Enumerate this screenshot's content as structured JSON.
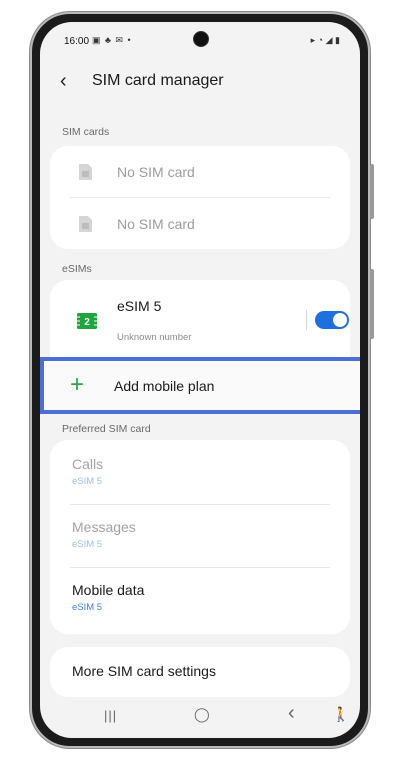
{
  "status_bar": {
    "time": "16:00",
    "left_icons": "▣ ♣ ✉ •",
    "right_icons": "▸ ◔ ◢ ▮"
  },
  "header": {
    "title": "SIM card manager"
  },
  "sim_cards": {
    "section_label": "SIM cards",
    "items": [
      {
        "label": "No SIM card"
      },
      {
        "label": "No SIM card"
      }
    ]
  },
  "esims": {
    "section_label": "eSIMs",
    "item": {
      "name": "eSIM 5",
      "subtitle": "Unknown number",
      "badge": "2",
      "enabled": true
    },
    "add_label": "Add mobile plan"
  },
  "preferred": {
    "section_label": "Preferred SIM card",
    "items": [
      {
        "title": "Calls",
        "value": "eSIM 5"
      },
      {
        "title": "Messages",
        "value": "eSIM 5"
      },
      {
        "title": "Mobile data",
        "value": "eSIM 5"
      }
    ]
  },
  "more_settings_label": "More SIM card settings",
  "navbar": {
    "recents": "|||",
    "home": "◯",
    "back": "‹",
    "accessibility": "🚶"
  },
  "colors": {
    "accent_blue": "#1f6fe0",
    "highlight_border": "#4b6fd4",
    "plus_green": "#27a844",
    "sub_blue": "#3b83e8"
  }
}
